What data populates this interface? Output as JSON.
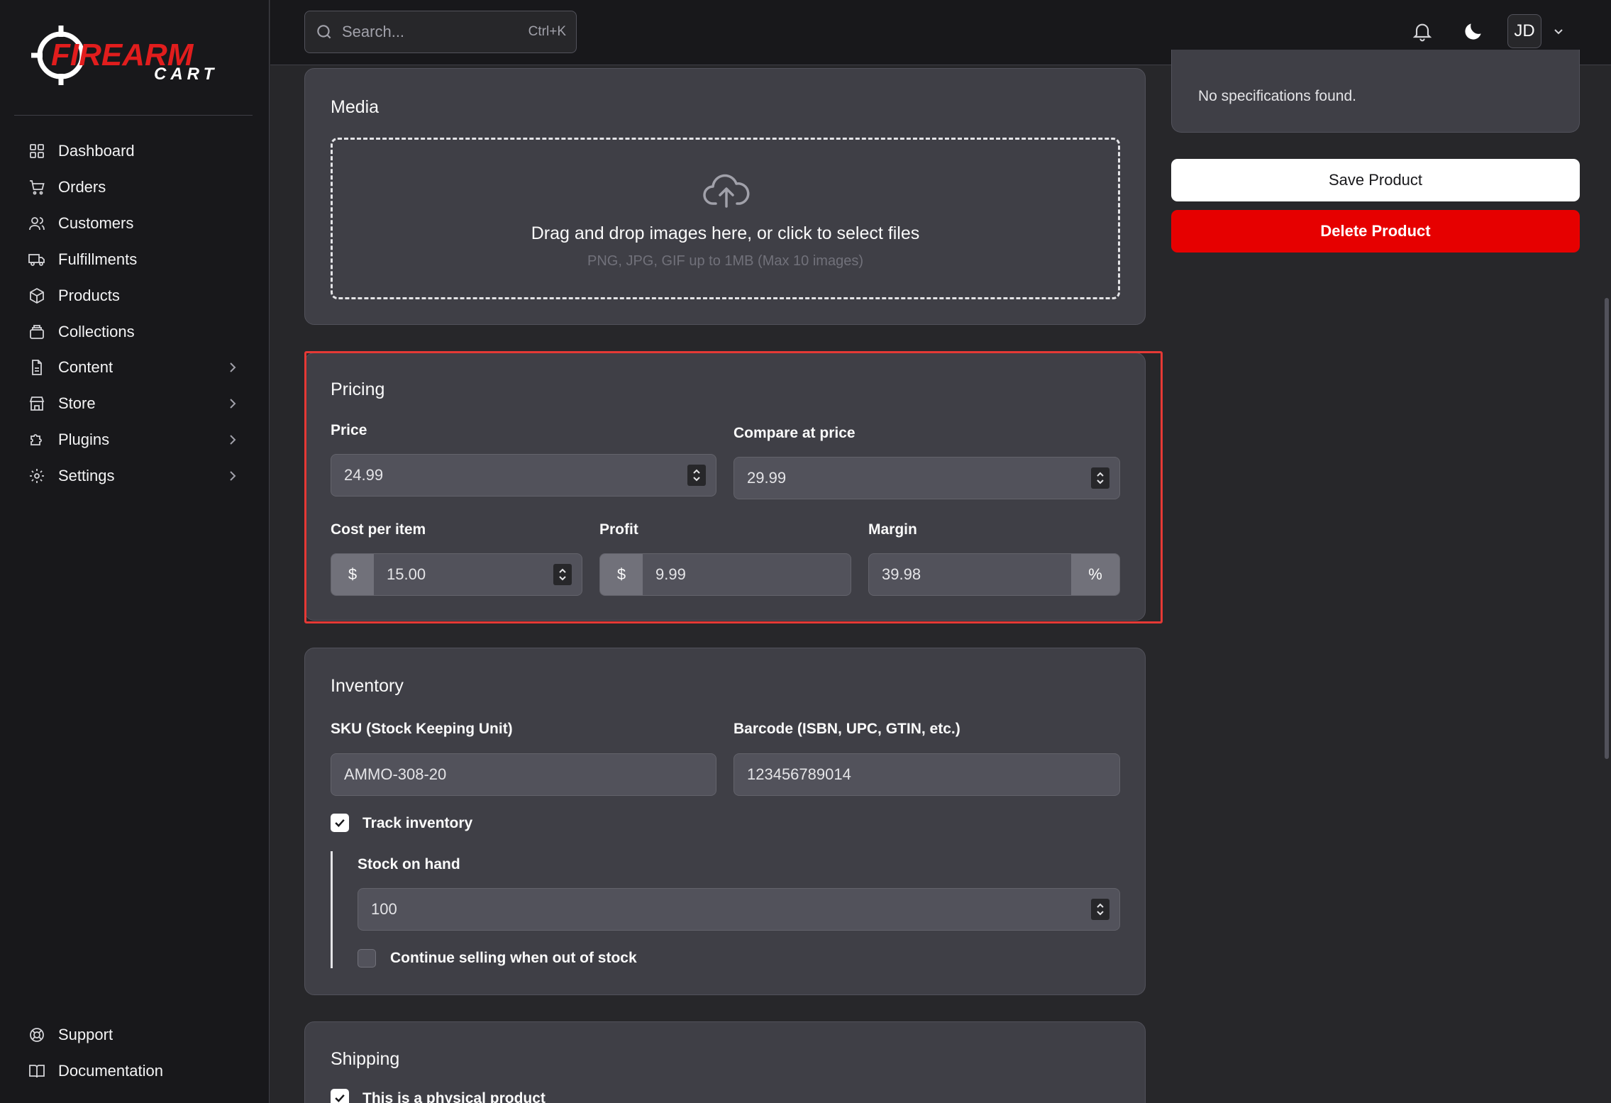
{
  "brand": {
    "word_top": "FIREARM",
    "word_bottom": "CART"
  },
  "colors": {
    "accent": "#e11d1d",
    "highlight_border": "#e53935",
    "bg": "#27272a",
    "card": "#3f3f46"
  },
  "search": {
    "placeholder": "Search...",
    "shortcut": "Ctrl+K"
  },
  "user": {
    "initials": "JD"
  },
  "sidebar": {
    "items": [
      {
        "label": "Dashboard",
        "icon": "grid-icon"
      },
      {
        "label": "Orders",
        "icon": "cart-icon"
      },
      {
        "label": "Customers",
        "icon": "users-icon"
      },
      {
        "label": "Fulfillments",
        "icon": "truck-icon"
      },
      {
        "label": "Products",
        "icon": "box-icon"
      },
      {
        "label": "Collections",
        "icon": "layers-icon"
      },
      {
        "label": "Content",
        "icon": "file-icon"
      },
      {
        "label": "Store",
        "icon": "store-icon"
      },
      {
        "label": "Plugins",
        "icon": "puzzle-icon"
      },
      {
        "label": "Settings",
        "icon": "gear-icon"
      }
    ],
    "footer": [
      {
        "label": "Support",
        "icon": "lifebuoy-icon"
      },
      {
        "label": "Documentation",
        "icon": "book-icon"
      }
    ]
  },
  "specs": {
    "empty_text": "No specifications found."
  },
  "actions": {
    "save": "Save Product",
    "delete": "Delete Product"
  },
  "media": {
    "title": "Media",
    "drop_text": "Drag and drop images here, or click to select files",
    "hint": "PNG, JPG, GIF up to 1MB (Max 10 images)"
  },
  "pricing": {
    "title": "Pricing",
    "price_label": "Price",
    "price": "24.99",
    "compare_label": "Compare at price",
    "compare": "29.99",
    "cost_label": "Cost per item",
    "cost": "15.00",
    "profit_label": "Profit",
    "profit": "9.99",
    "margin_label": "Margin",
    "margin": "39.98",
    "currency": "$",
    "percent": "%"
  },
  "inventory": {
    "title": "Inventory",
    "sku_label": "SKU (Stock Keeping Unit)",
    "sku": "AMMO-308-20",
    "barcode_label": "Barcode (ISBN, UPC, GTIN, etc.)",
    "barcode": "123456789014",
    "track_label": "Track inventory",
    "track_checked": true,
    "stock_label": "Stock on hand",
    "stock": "100",
    "continue_label": "Continue selling when out of stock",
    "continue_checked": false
  },
  "shipping": {
    "title": "Shipping",
    "physical_label": "This is a physical product",
    "physical_checked": true
  }
}
